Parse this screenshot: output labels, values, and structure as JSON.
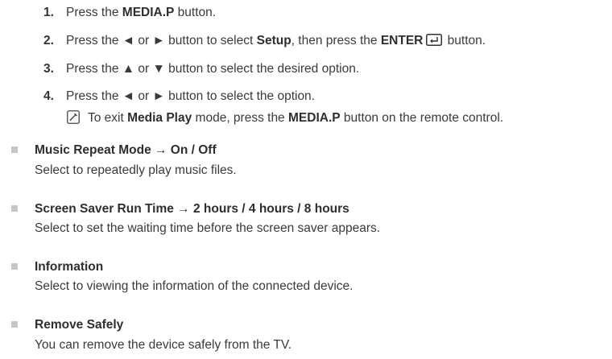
{
  "steps": [
    {
      "num": "1.",
      "pre": "Press the ",
      "bold1": "MEDIA.P",
      "post": " button."
    },
    {
      "num": "2.",
      "pre": "Press the ◄ or ► button to select ",
      "bold1": "Setup",
      "mid": ", then press the ",
      "bold2": "ENTER",
      "post": " button."
    },
    {
      "num": "3.",
      "pre": "Press the ▲ or ▼ button to select the desired option."
    },
    {
      "num": "4.",
      "pre": "Press the ◄ or ► button to select the option."
    }
  ],
  "note": {
    "icon": "note-icon",
    "pre": "To exit ",
    "bold1": "Media Play",
    "mid": " mode, press the ",
    "bold2": "MEDIA.P",
    "post": " button on the remote control."
  },
  "options": [
    {
      "title": "Music Repeat Mode → On / Off",
      "desc": "Select to repeatedly play music files."
    },
    {
      "title": "Screen Saver Run Time → 2 hours / 4 hours / 8 hours",
      "desc": "Select to set the waiting time before the screen saver appears."
    },
    {
      "title": "Information",
      "desc": "Select to viewing the information of the connected device."
    },
    {
      "title": "Remove Safely",
      "desc": "You can remove the device safely from the TV."
    }
  ],
  "colors": {
    "text": "#3a3a3a",
    "bullet": "#c6c6c6"
  }
}
